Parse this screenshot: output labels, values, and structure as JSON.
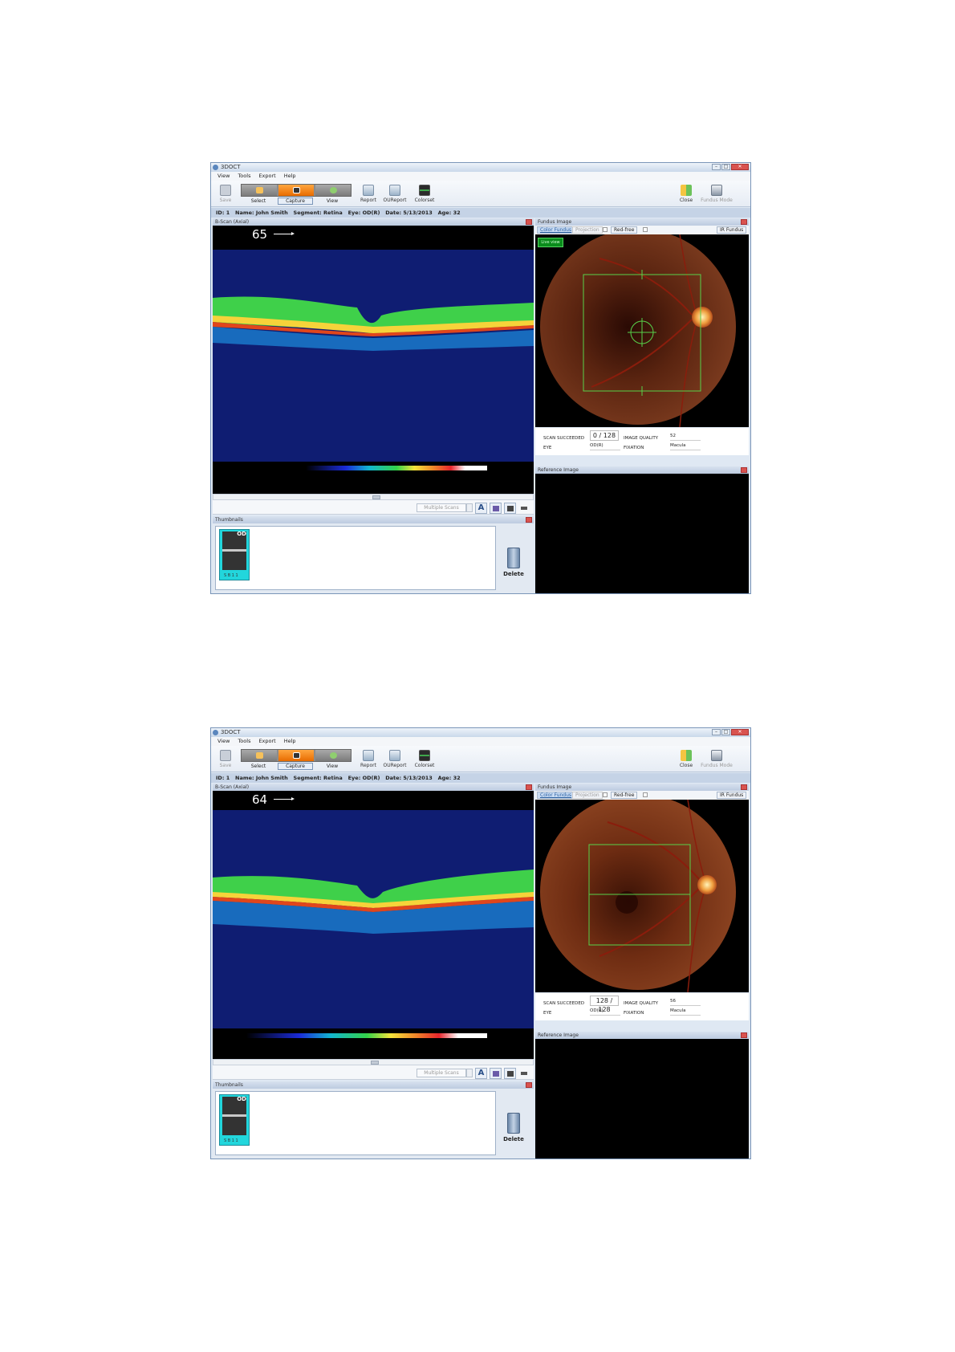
{
  "app": {
    "title": "3DOCT"
  },
  "menu": [
    "View",
    "Tools",
    "Export",
    "Help"
  ],
  "toolbar": {
    "save": "Save",
    "select": "Select",
    "capture": "Capture",
    "view": "View",
    "report": "Report",
    "oureport": "OUReport",
    "colorset": "Colorset",
    "close": "Close",
    "fundus_mode": "Fundus Mode"
  },
  "patient": {
    "id_label": "ID:",
    "id": "1",
    "name_label": "Name:",
    "name": "John Smith",
    "segment_label": "Segment:",
    "segment": "Retina",
    "eye_label": "Eye:",
    "eye": "OD(R)",
    "date_label": "Date:",
    "date": "5/13/2013",
    "age_label": "Age:",
    "age": "32"
  },
  "bscan": {
    "title": "B-Scan (Axial)"
  },
  "view_controls": {
    "multiple_scans": "Multiple Scans",
    "text_tool": "A"
  },
  "thumbnails": {
    "title": "Thumbnails",
    "delete": "Delete",
    "eye_label": "OD",
    "info": "S  B\n  1 1"
  },
  "fundus": {
    "title": "Fundus Image",
    "tab_color": "Color Fundus",
    "tab_projection": "Projection",
    "tab_redfree": "Red-free",
    "tab_ir": "IR Fundus",
    "live_label": "Live view"
  },
  "scan_info": {
    "succeeded_label": "SCAN SUCCEEDED",
    "image_quality_label": "IMAGE QUALITY",
    "eye_label": "EYE",
    "fixation_label": "FIXATION",
    "eye_value": "OD(R)",
    "fixation_value": "Macula"
  },
  "reference": {
    "title": "Reference Image"
  },
  "screens": [
    {
      "frame": "65",
      "scan_count": "0 / 128",
      "image_quality": "52"
    },
    {
      "frame": "64",
      "scan_count": "128 / 128",
      "image_quality": "56"
    }
  ],
  "colors": {
    "active_mode": "#f28a10",
    "retina_green": "#3fd04a",
    "retina_red": "#e0461c",
    "scan_frame": "#58d24a"
  }
}
